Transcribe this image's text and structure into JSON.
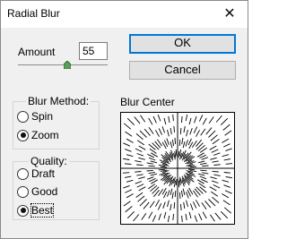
{
  "window": {
    "title": "Radial Blur",
    "close_glyph": "✕"
  },
  "amount": {
    "label": "Amount",
    "value": "55",
    "slider_level": 0.55
  },
  "buttons": {
    "ok": "OK",
    "cancel": "Cancel"
  },
  "blur_method": {
    "legend": "Blur Method:",
    "options": [
      {
        "label": "Spin",
        "checked": false
      },
      {
        "label": "Zoom",
        "checked": true
      }
    ]
  },
  "quality": {
    "legend": "Quality:",
    "options": [
      {
        "label": "Draft",
        "checked": false
      },
      {
        "label": "Good",
        "checked": false
      },
      {
        "label": "Best",
        "checked": true
      }
    ]
  },
  "blur_center": {
    "label": "Blur Center"
  },
  "icons": {
    "close": "close-icon",
    "slider_thumb": "slider-thumb-icon"
  }
}
